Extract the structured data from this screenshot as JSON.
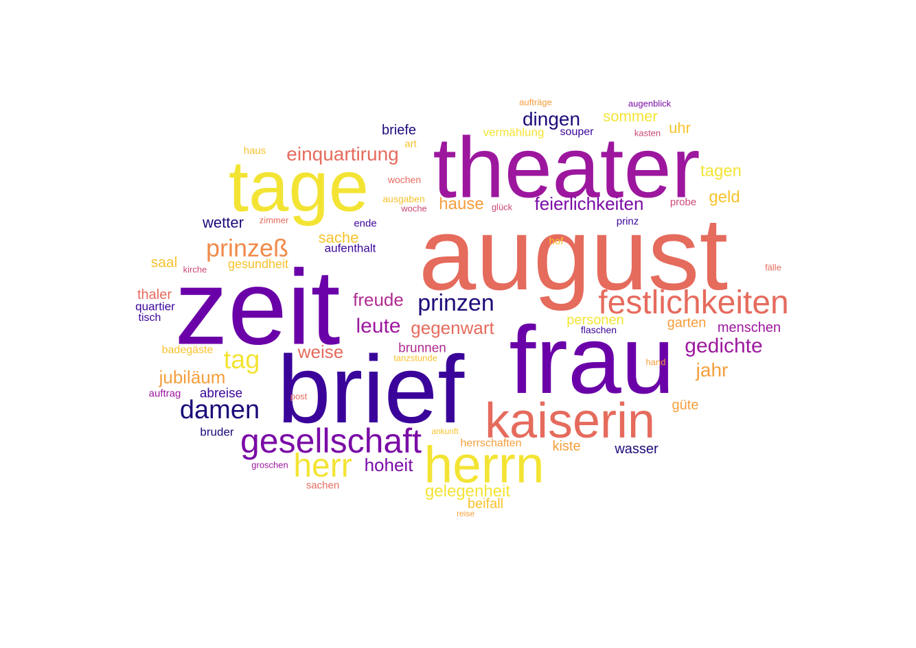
{
  "word_cloud": {
    "palette": {
      "yellow": "#f3e434",
      "gold": "#f8c22c",
      "orange": "#f59e3c",
      "salmon": "#e56b5d",
      "rose": "#cc4778",
      "magenta": "#9c179e",
      "purple": "#6a00a8",
      "indigo": "#3a049a",
      "navy": "#1a0b79"
    },
    "words": [
      {
        "text": "august",
        "color": "#e56b5d"
      },
      {
        "text": "theater",
        "color": "#9c179e"
      },
      {
        "text": "zeit",
        "color": "#6a00a8"
      },
      {
        "text": "brief",
        "color": "#3a049a"
      },
      {
        "text": "frau",
        "color": "#6a00a8"
      },
      {
        "text": "tage",
        "color": "#f3e434"
      },
      {
        "text": "kaiserin",
        "color": "#e56b5d"
      },
      {
        "text": "herrn",
        "color": "#f3e434"
      },
      {
        "text": "festlichkeiten",
        "color": "#e56b5d"
      },
      {
        "text": "gesellschaft",
        "color": "#7a0ba6"
      },
      {
        "text": "herr",
        "color": "#f3e434"
      },
      {
        "text": "damen",
        "color": "#1a0b79"
      },
      {
        "text": "prinzen",
        "color": "#1a0b79"
      },
      {
        "text": "tag",
        "color": "#f3e434"
      },
      {
        "text": "prinzeß",
        "color": "#f08a4b"
      },
      {
        "text": "gedichte",
        "color": "#9c179e"
      },
      {
        "text": "dingen",
        "color": "#1a0b79"
      },
      {
        "text": "feierlichkeiten",
        "color": "#7a0ba6"
      },
      {
        "text": "einquartirung",
        "color": "#e56b5d"
      },
      {
        "text": "leute",
        "color": "#9c179e"
      },
      {
        "text": "gegenwart",
        "color": "#e56b5d"
      },
      {
        "text": "freude",
        "color": "#b02a90"
      },
      {
        "text": "jubiläum",
        "color": "#f59e3c"
      },
      {
        "text": "jahr",
        "color": "#f59e3c"
      },
      {
        "text": "weise",
        "color": "#e56b5d"
      },
      {
        "text": "hoheit",
        "color": "#7a0ba6"
      },
      {
        "text": "gelegenheit",
        "color": "#f3e434"
      },
      {
        "text": "hause",
        "color": "#f59e3c"
      },
      {
        "text": "wetter",
        "color": "#1a0b79"
      },
      {
        "text": "sache",
        "color": "#f8c22c"
      },
      {
        "text": "sommer",
        "color": "#f3e434"
      },
      {
        "text": "tagen",
        "color": "#f3e434"
      },
      {
        "text": "geld",
        "color": "#f8c22c"
      },
      {
        "text": "uhr",
        "color": "#f8c22c"
      },
      {
        "text": "garten",
        "color": "#f59e3c"
      },
      {
        "text": "menschen",
        "color": "#9c179e"
      },
      {
        "text": "personen",
        "color": "#f3e434"
      },
      {
        "text": "beifall",
        "color": "#f8c22c"
      },
      {
        "text": "saal",
        "color": "#f8c22c"
      },
      {
        "text": "brunnen",
        "color": "#b02a90"
      },
      {
        "text": "thaler",
        "color": "#e56b5d"
      },
      {
        "text": "briefe",
        "color": "#1a0b79"
      },
      {
        "text": "abreise",
        "color": "#3a049a"
      },
      {
        "text": "kiste",
        "color": "#f59e3c"
      },
      {
        "text": "wasser",
        "color": "#1a0b79"
      },
      {
        "text": "güte",
        "color": "#f59e3c"
      },
      {
        "text": "bruder",
        "color": "#1a0b79"
      },
      {
        "text": "gesundheit",
        "color": "#f8c22c"
      },
      {
        "text": "aufenthalt",
        "color": "#3a049a"
      },
      {
        "text": "quartier",
        "color": "#3a049a"
      },
      {
        "text": "vermählung",
        "color": "#f3e434"
      },
      {
        "text": "souper",
        "color": "#3a049a"
      },
      {
        "text": "herrschaften",
        "color": "#f59e3c"
      },
      {
        "text": "tisch",
        "color": "#3a049a"
      },
      {
        "text": "badegäste",
        "color": "#f8c22c"
      },
      {
        "text": "flaschen",
        "color": "#3a049a"
      },
      {
        "text": "prinz",
        "color": "#3a049a"
      },
      {
        "text": "ende",
        "color": "#3a049a"
      },
      {
        "text": "probe",
        "color": "#cc4778"
      },
      {
        "text": "hof",
        "color": "#f8c22c"
      },
      {
        "text": "auftrag",
        "color": "#9c179e"
      },
      {
        "text": "groschen",
        "color": "#9c179e"
      },
      {
        "text": "sachen",
        "color": "#e56b5d"
      },
      {
        "text": "haus",
        "color": "#f8c22c"
      },
      {
        "text": "art",
        "color": "#f8c22c"
      },
      {
        "text": "wochen",
        "color": "#e56b5d"
      },
      {
        "text": "ausgaben",
        "color": "#f8c22c"
      },
      {
        "text": "woche",
        "color": "#cc4778"
      },
      {
        "text": "glück",
        "color": "#cc4778"
      },
      {
        "text": "zimmer",
        "color": "#e56b5d"
      },
      {
        "text": "kirche",
        "color": "#cc4778"
      },
      {
        "text": "aufträge",
        "color": "#f59e3c"
      },
      {
        "text": "augenblick",
        "color": "#7a0ba6"
      },
      {
        "text": "kasten",
        "color": "#cc4778"
      },
      {
        "text": "tanzstunde",
        "color": "#f8c22c"
      },
      {
        "text": "hand",
        "color": "#f59e3c"
      },
      {
        "text": "post",
        "color": "#e56b5d"
      },
      {
        "text": "ankunft",
        "color": "#f8c22c"
      },
      {
        "text": "reise",
        "color": "#f59e3c"
      },
      {
        "text": "fälle",
        "color": "#e56b5d"
      }
    ]
  }
}
